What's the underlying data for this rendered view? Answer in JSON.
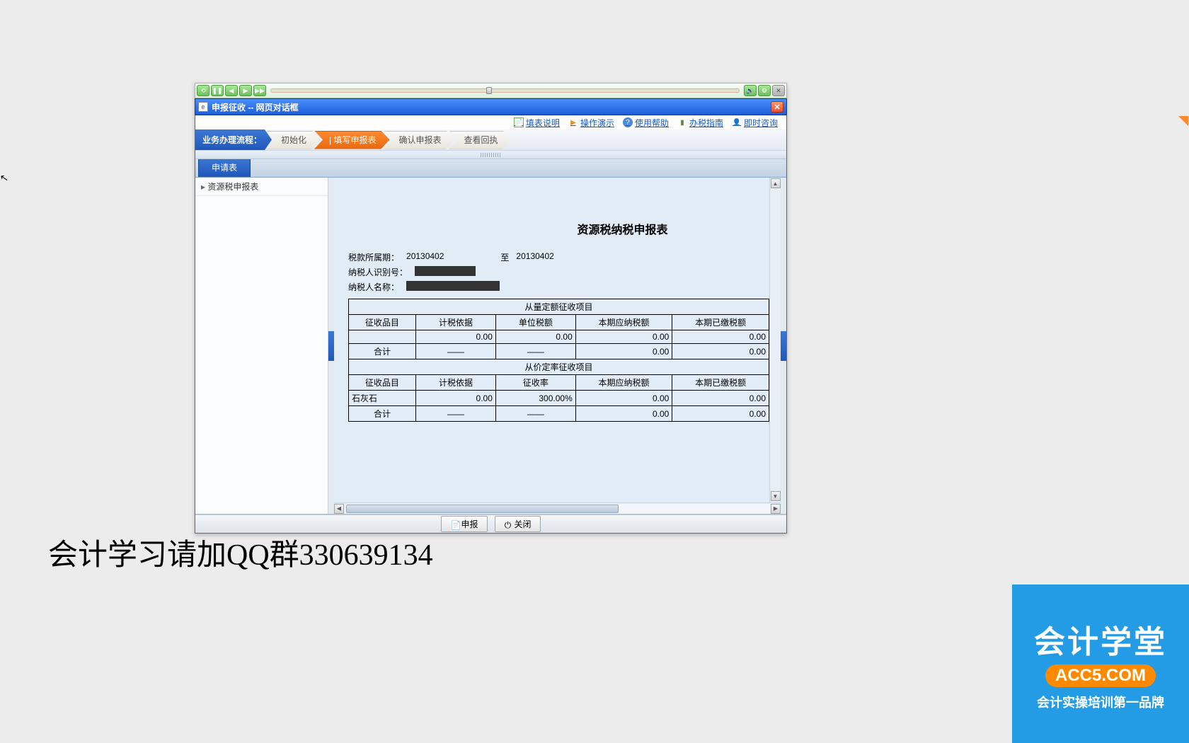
{
  "player": {},
  "window": {
    "title": "申报征收 -- 网页对话框"
  },
  "help_links": {
    "fillhelp": "填表说明",
    "demo": "操作演示",
    "usage": "使用帮助",
    "guide": "办税指南",
    "consult": "即时咨询"
  },
  "workflow": {
    "label": "业务办理流程：",
    "step1": "初始化",
    "step2": "| 填写申报表",
    "step3": "确认申报表",
    "step4": "查看回执"
  },
  "tab": {
    "label": "申请表"
  },
  "tree": {
    "item1": "资源税申报表"
  },
  "form": {
    "title": "资源税纳税申报表",
    "period_label": "税款所属期：",
    "period_from": "20130402",
    "period_to_label": "至",
    "period_to": "20130402",
    "tin_label": "纳税人识别号：",
    "name_label": "纳税人名称：",
    "section1": "从量定额征收项目",
    "section2": "从价定率征收项目",
    "cols": {
      "item": "征收品目",
      "basis": "计税依据",
      "unit": "单位税额",
      "rate": "征收率",
      "payable": "本期应纳税额",
      "paid": "本期已缴税额"
    },
    "rows1": [
      {
        "item": "",
        "basis": "0.00",
        "unit": "0.00",
        "payable": "0.00",
        "paid": "0.00"
      }
    ],
    "sum1": {
      "item": "合计",
      "basis": "——",
      "unit": "——",
      "payable": "0.00",
      "paid": "0.00"
    },
    "rows2": [
      {
        "item": "石灰石",
        "basis": "0.00",
        "rate": "300.00%",
        "payable": "0.00",
        "paid": "0.00"
      }
    ],
    "sum2": {
      "item": "合计",
      "basis": "——",
      "rate": "——",
      "payable": "0.00",
      "paid": "0.00"
    }
  },
  "footer": {
    "submit": "申报",
    "close": "关闭"
  },
  "overlay": {
    "text": "会计学习请加QQ群330639134",
    "brand_big": "会计学堂",
    "brand_pill": "ACC5.COM",
    "brand_small": "会计实操培训第一品牌"
  }
}
